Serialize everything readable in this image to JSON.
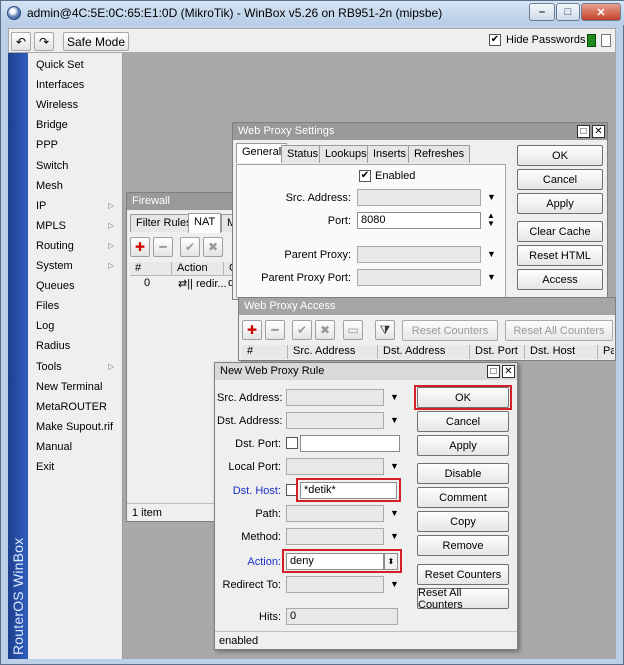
{
  "window": {
    "title": "admin@4C:5E:0C:65:E1:0D (MikroTik) - WinBox v5.26 on RB951-2n (mipsbe)",
    "minimize": "–",
    "maximize": "□",
    "close": "✕"
  },
  "toolbar": {
    "undo": "↶",
    "redo": "↷",
    "safe_mode": "Safe Mode",
    "hide_passwords": "Hide Passwords",
    "hide_passwords_checked": "✔"
  },
  "brand": "RouterOS WinBox",
  "menu": [
    {
      "label": "Quick Set",
      "arrow": ""
    },
    {
      "label": "Interfaces",
      "arrow": ""
    },
    {
      "label": "Wireless",
      "arrow": ""
    },
    {
      "label": "Bridge",
      "arrow": ""
    },
    {
      "label": "PPP",
      "arrow": ""
    },
    {
      "label": "Switch",
      "arrow": ""
    },
    {
      "label": "Mesh",
      "arrow": ""
    },
    {
      "label": "IP",
      "arrow": "▷"
    },
    {
      "label": "MPLS",
      "arrow": "▷"
    },
    {
      "label": "Routing",
      "arrow": "▷"
    },
    {
      "label": "System",
      "arrow": "▷"
    },
    {
      "label": "Queues",
      "arrow": ""
    },
    {
      "label": "Files",
      "arrow": ""
    },
    {
      "label": "Log",
      "arrow": ""
    },
    {
      "label": "Radius",
      "arrow": ""
    },
    {
      "label": "Tools",
      "arrow": "▷"
    },
    {
      "label": "New Terminal",
      "arrow": ""
    },
    {
      "label": "MetaROUTER",
      "arrow": ""
    },
    {
      "label": "Make Supout.rif",
      "arrow": ""
    },
    {
      "label": "Manual",
      "arrow": ""
    },
    {
      "label": "Exit",
      "arrow": ""
    }
  ],
  "firewall": {
    "title": "Firewall",
    "tabs": [
      "Filter Rules",
      "NAT",
      "M"
    ],
    "add": "✚",
    "remove": "━",
    "enable": "✔",
    "disable": "✖",
    "columns": [
      "#",
      "Action",
      "C"
    ],
    "row": {
      "num": "0",
      "action": "⇄|| redir...",
      "c": "ds"
    },
    "status": "1 item"
  },
  "proxy_settings": {
    "title": "Web Proxy Settings",
    "tabs": [
      "General",
      "Status",
      "Lookups",
      "Inserts",
      "Refreshes"
    ],
    "enabled_label": "Enabled",
    "enabled_check": "✔",
    "src_address_label": "Src. Address:",
    "src_address_value": "",
    "port_label": "Port:",
    "port_value": "8080",
    "parent_proxy_label": "Parent Proxy:",
    "parent_proxy_value": "",
    "parent_proxy_port_label": "Parent Proxy Port:",
    "parent_proxy_port_value": "",
    "buttons": [
      "OK",
      "Cancel",
      "Apply",
      "Clear Cache",
      "Reset HTML",
      "Access"
    ]
  },
  "proxy_access": {
    "title": "Web Proxy Access",
    "add": "✚",
    "remove": "━",
    "enable": "✔",
    "disable": "✖",
    "comment": "▭",
    "filter": "⧩",
    "reset_counters": "Reset Counters",
    "reset_all_counters": "Reset All Counters",
    "columns": [
      "#",
      "Src. Address",
      "Dst. Address",
      "Dst. Port",
      "Dst. Host",
      "Path"
    ]
  },
  "new_rule": {
    "title": "New Web Proxy Rule",
    "src_address_label": "Src. Address:",
    "src_address_value": "",
    "dst_address_label": "Dst. Address:",
    "dst_address_value": "",
    "dst_port_label": "Dst. Port:",
    "dst_port_value": "",
    "local_port_label": "Local Port:",
    "local_port_value": "",
    "dst_host_label": "Dst. Host:",
    "dst_host_value": "*detik*",
    "path_label": "Path:",
    "path_value": "",
    "method_label": "Method:",
    "method_value": "",
    "action_label": "Action:",
    "action_value": "deny",
    "redirect_label": "Redirect To:",
    "redirect_value": "",
    "hits_label": "Hits:",
    "hits_value": "0",
    "buttons": [
      "OK",
      "Cancel",
      "Apply",
      "Disable",
      "Comment",
      "Copy",
      "Remove",
      "Reset Counters",
      "Reset All Counters"
    ],
    "status": "enabled"
  },
  "icons": {
    "dropdown": "▼",
    "up": "▲",
    "spin": "⬍",
    "combo": "⏷"
  },
  "colors": {
    "highlight_red": "#d21f2a",
    "label_blue": "#1a30c8",
    "menu_strip": "#2f5fc0"
  }
}
